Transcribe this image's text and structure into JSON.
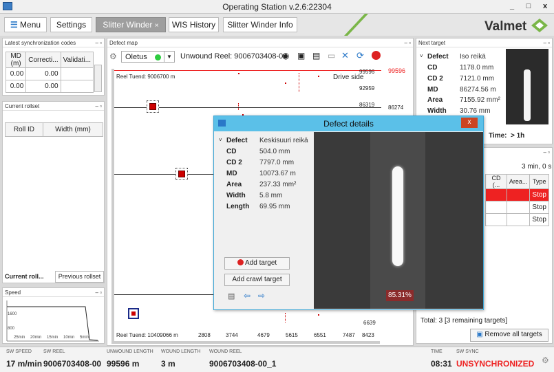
{
  "window": {
    "title": "Operating Station v.2.6:22304",
    "min": "_",
    "max": "□",
    "close": "x"
  },
  "tabs": {
    "menu": "Menu",
    "settings": "Settings",
    "slitter_winder": "Slitter Winder",
    "slitter_winder_close": "×",
    "wis_history": "WIS History",
    "slitter_winder_info": "Slitter Winder Info"
  },
  "brand": {
    "name": "Valmet"
  },
  "sync_panel": {
    "title": "Latest synchronization codes",
    "headers": [
      "MD (m)",
      "Correcti...",
      "Validati..."
    ],
    "rows": [
      [
        "0.00",
        "0.00",
        ""
      ],
      [
        "0.00",
        "0.00",
        ""
      ]
    ]
  },
  "rollset_panel": {
    "title": "Current rollset",
    "headers": [
      "Roll ID",
      "Width (mm)"
    ],
    "tab_current": "Current roll...",
    "tab_previous": "Previous rollset"
  },
  "speed_panel": {
    "title": "Speed",
    "y_ticks": [
      "1600",
      "800"
    ],
    "x_ticks": [
      "25min",
      "20min",
      "15min",
      "10min",
      "5min"
    ]
  },
  "defect_map": {
    "title": "Defect map",
    "preset": "Oletus",
    "unwound_reel": "Unwound Reel: 9006703408-00",
    "drive_side": "Drive side",
    "reel_top": "Reel Tuend: 9006700 m",
    "reel_bottom": "Reel Tuend: 10409066 m",
    "right_ticks": [
      "99596",
      "92959",
      "86319",
      "6639",
      "8423"
    ],
    "red_labels": [
      "99596"
    ],
    "side_label": "86274",
    "bottom_ticks": [
      "2808",
      "3744",
      "4679",
      "5615",
      "6551",
      "7487"
    ]
  },
  "next_target": {
    "title": "Next target",
    "defect_label": "Defect",
    "defect_value": "Iso reikä",
    "cd_label": "CD",
    "cd_value": "1178.0 mm",
    "cd2_label": "CD 2",
    "cd2_value": "7121.0 mm",
    "md_label": "MD",
    "md_value": "86274.56 m",
    "area_label": "Area",
    "area_value": "7155.92 mm²",
    "width_label": "Width",
    "width_value": "30.76 mm",
    "time_label": "Time:",
    "time_value": "> 1h"
  },
  "targets": {
    "countdown": "3 min, 0 s",
    "headers": [
      "CD (...",
      "Area...",
      "Type"
    ],
    "rows": [
      [
        "",
        "",
        "Stop"
      ],
      [
        "",
        "",
        "Stop"
      ],
      [
        "",
        "",
        "Stop"
      ]
    ],
    "total": "Total: 3 [3 remaining targets]",
    "remove_all": "Remove all targets"
  },
  "dialog": {
    "title": "Defect details",
    "close": "x",
    "defect_label": "Defect",
    "defect_value": "Keskisuuri reikä",
    "cd_label": "CD",
    "cd_value": "504.0 mm",
    "cd2_label": "CD 2",
    "cd2_value": "7797.0 mm",
    "md_label": "MD",
    "md_value": "10073.67 m",
    "area_label": "Area",
    "area_value": "237.33 mm²",
    "width_label": "Width",
    "width_value": "5.8 mm",
    "length_label": "Length",
    "length_value": "69.95 mm",
    "add_target": "Add target",
    "add_crawl_target": "Add crawl target",
    "confidence": "85.31%"
  },
  "status": {
    "sw_speed_label": "SW SPEED",
    "sw_speed": "17 m/min",
    "sw_reel_label": "SW REEL",
    "sw_reel": "9006703408-00",
    "unwound_length_label": "UNWOUND LENGTH",
    "unwound_length": "99596 m",
    "wound_length_label": "WOUND LENGTH",
    "wound_length": "3 m",
    "wound_reel_label": "WOUND REEL",
    "wound_reel": "9006703408-00_1",
    "time_label": "TIME",
    "time": "08:31",
    "sw_sync_label": "SW SYNC",
    "sw_sync": "UNSYNCHRONIZED"
  },
  "colors": {
    "accent": "#5bc0e8",
    "alarm": "#ee2222",
    "brand_green": "#7ab648"
  }
}
